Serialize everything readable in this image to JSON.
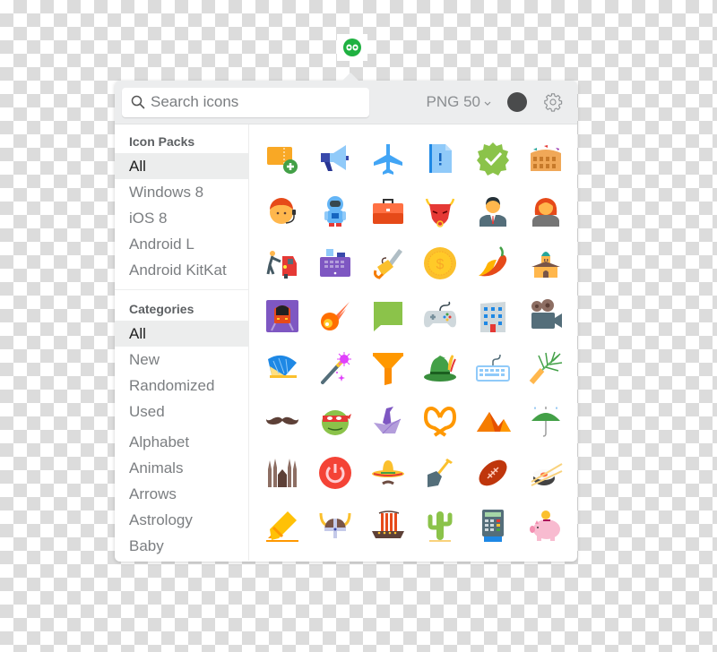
{
  "tray": {
    "icon": "icons8-infinity-logo-icon",
    "color": "#1fb141"
  },
  "toolbar": {
    "search_placeholder": "Search icons",
    "search_value": "",
    "format_label": "PNG 50",
    "format_chevron": "⌄",
    "color_value": "#4a4b4c",
    "settings_icon": "gear-icon"
  },
  "sidebar": {
    "icon_packs_title": "Icon Packs",
    "icon_packs": [
      {
        "label": "All",
        "active": true
      },
      {
        "label": "Windows 8",
        "active": false
      },
      {
        "label": "iOS 8",
        "active": false
      },
      {
        "label": "Android L",
        "active": false
      },
      {
        "label": "Android KitKat",
        "active": false
      }
    ],
    "categories_title": "Categories",
    "categories_special": [
      {
        "label": "All",
        "active": true
      },
      {
        "label": "New",
        "active": false
      },
      {
        "label": "Randomized",
        "active": false
      },
      {
        "label": "Used",
        "active": false
      }
    ],
    "categories": [
      {
        "label": "Alphabet"
      },
      {
        "label": "Animals"
      },
      {
        "label": "Arrows"
      },
      {
        "label": "Astrology"
      },
      {
        "label": "Baby"
      }
    ]
  },
  "icons": [
    "add-ticket",
    "megaphone",
    "airplane",
    "document-alert",
    "verified-badge",
    "colosseum",
    "customer-support",
    "astronaut",
    "briefcase",
    "bull",
    "businessman",
    "businesswoman",
    "car-push",
    "cash-register",
    "chainsaw",
    "coin",
    "chili-pepper",
    "church",
    "train",
    "comet",
    "chat-bubble",
    "gamepad",
    "office-building",
    "video-camera",
    "hand-fan",
    "magic-wand",
    "funnel",
    "tyrolean-hat",
    "keyboard",
    "palm-branch",
    "mustache",
    "ninja-turtle",
    "origami-swan",
    "pretzel",
    "pyramids",
    "umbrella-rain",
    "sagrada-familia",
    "power-button",
    "sombrero",
    "shovel",
    "rugby-ball",
    "sushi",
    "highlighter",
    "viking-helmet",
    "viking-ship",
    "cactus",
    "card-terminal",
    "piggy-bank"
  ]
}
